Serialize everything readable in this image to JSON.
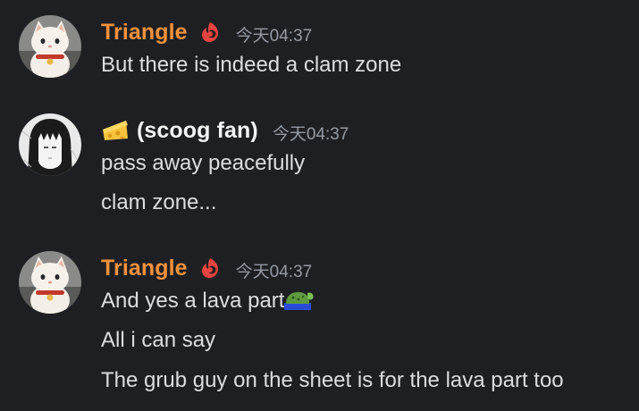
{
  "messages": [
    {
      "username": "Triangle",
      "timestamp": "今天04:37",
      "lines": [
        "But there is indeed a clam zone"
      ]
    },
    {
      "username": "(scoog fan)",
      "timestamp": "今天04:37",
      "lines": [
        "pass away peacefully",
        "clam zone..."
      ]
    },
    {
      "username": "Triangle",
      "timestamp": "今天04:37",
      "lines": [
        "And yes a lava part",
        "All i can say",
        "The grub guy on the sheet is for the lava part too"
      ]
    }
  ],
  "icons": {
    "cat_avatar": "cat-avatar",
    "anime_avatar": "anime-girl-avatar",
    "role_icon": "flame-crescent-icon",
    "cheese_emoji": "cheese-icon",
    "lava_emoji": "grub-lava-emoji"
  },
  "colors": {
    "background": "#1e1f22",
    "username_orange": "#f0913c",
    "username_white": "#f2f3f5",
    "message_text": "#dbdee1",
    "timestamp": "#949ba4"
  }
}
